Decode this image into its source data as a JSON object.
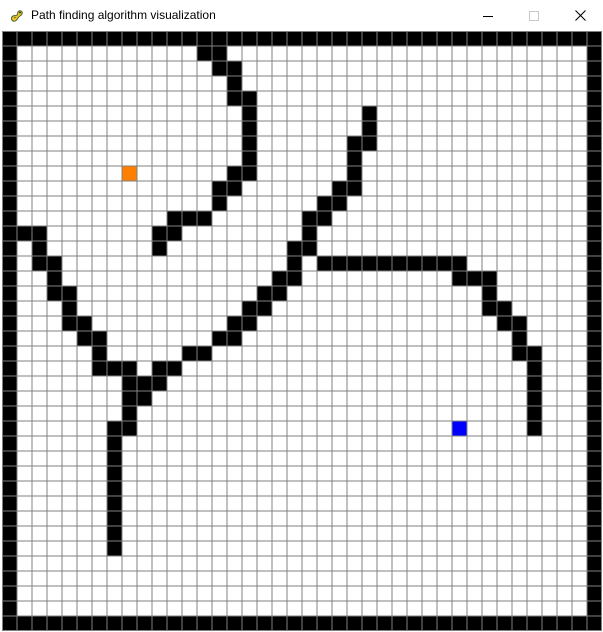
{
  "window": {
    "title": "Path finding algorithm visualization",
    "app_icon": "pygame-snake-icon",
    "controls": {
      "minimize_icon": "minimize-icon",
      "maximize_icon": "maximize-icon",
      "close_icon": "close-icon"
    }
  },
  "grid": {
    "cols": 40,
    "rows": 40,
    "colors": {
      "empty": "#ffffff",
      "line": "#808080",
      "barrier": "#000000",
      "start": "#ff8000",
      "end": "#0000ff"
    },
    "start": [
      8,
      9
    ],
    "end": [
      30,
      26
    ],
    "barriers": [
      [
        13,
        1
      ],
      [
        14,
        1
      ],
      [
        14,
        2
      ],
      [
        15,
        2
      ],
      [
        15,
        3
      ],
      [
        15,
        4
      ],
      [
        16,
        4
      ],
      [
        16,
        5
      ],
      [
        16,
        6
      ],
      [
        16,
        7
      ],
      [
        16,
        8
      ],
      [
        16,
        9
      ],
      [
        15,
        9
      ],
      [
        15,
        10
      ],
      [
        14,
        10
      ],
      [
        14,
        11
      ],
      [
        13,
        12
      ],
      [
        12,
        12
      ],
      [
        11,
        12
      ],
      [
        11,
        13
      ],
      [
        10,
        13
      ],
      [
        10,
        14
      ],
      [
        24,
        5
      ],
      [
        24,
        6
      ],
      [
        24,
        7
      ],
      [
        23,
        7
      ],
      [
        23,
        8
      ],
      [
        23,
        9
      ],
      [
        23,
        10
      ],
      [
        22,
        10
      ],
      [
        22,
        11
      ],
      [
        21,
        11
      ],
      [
        21,
        12
      ],
      [
        20,
        12
      ],
      [
        20,
        13
      ],
      [
        20,
        14
      ],
      [
        19,
        14
      ],
      [
        19,
        15
      ],
      [
        19,
        16
      ],
      [
        18,
        16
      ],
      [
        18,
        17
      ],
      [
        17,
        17
      ],
      [
        17,
        18
      ],
      [
        16,
        18
      ],
      [
        16,
        19
      ],
      [
        15,
        19
      ],
      [
        15,
        20
      ],
      [
        14,
        20
      ],
      [
        13,
        21
      ],
      [
        12,
        21
      ],
      [
        11,
        22
      ],
      [
        10,
        22
      ],
      [
        10,
        23
      ],
      [
        9,
        23
      ],
      [
        9,
        24
      ],
      [
        8,
        24
      ],
      [
        8,
        25
      ],
      [
        8,
        26
      ],
      [
        7,
        26
      ],
      [
        7,
        27
      ],
      [
        7,
        28
      ],
      [
        7,
        29
      ],
      [
        7,
        30
      ],
      [
        7,
        31
      ],
      [
        7,
        32
      ],
      [
        7,
        33
      ],
      [
        7,
        34
      ],
      [
        1,
        13
      ],
      [
        2,
        13
      ],
      [
        2,
        14
      ],
      [
        2,
        15
      ],
      [
        3,
        15
      ],
      [
        3,
        16
      ],
      [
        3,
        17
      ],
      [
        4,
        17
      ],
      [
        4,
        18
      ],
      [
        4,
        19
      ],
      [
        5,
        19
      ],
      [
        5,
        20
      ],
      [
        6,
        20
      ],
      [
        6,
        21
      ],
      [
        6,
        22
      ],
      [
        7,
        22
      ],
      [
        8,
        22
      ],
      [
        8,
        23
      ],
      [
        9,
        23
      ],
      [
        21,
        15
      ],
      [
        22,
        15
      ],
      [
        23,
        15
      ],
      [
        24,
        15
      ],
      [
        25,
        15
      ],
      [
        26,
        15
      ],
      [
        27,
        15
      ],
      [
        28,
        15
      ],
      [
        29,
        15
      ],
      [
        30,
        15
      ],
      [
        30,
        16
      ],
      [
        31,
        16
      ],
      [
        32,
        16
      ],
      [
        32,
        17
      ],
      [
        32,
        18
      ],
      [
        33,
        18
      ],
      [
        33,
        19
      ],
      [
        34,
        19
      ],
      [
        34,
        20
      ],
      [
        34,
        21
      ],
      [
        35,
        21
      ],
      [
        35,
        22
      ],
      [
        35,
        23
      ],
      [
        35,
        24
      ],
      [
        35,
        25
      ],
      [
        35,
        26
      ]
    ]
  }
}
